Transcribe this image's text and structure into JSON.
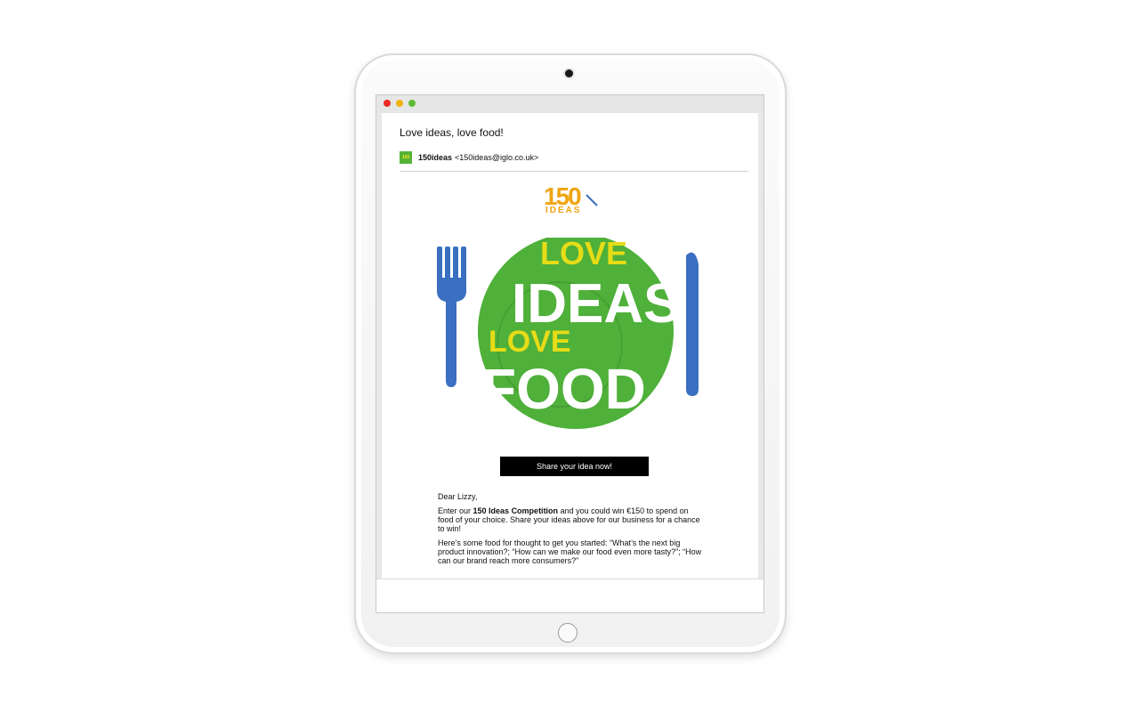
{
  "email": {
    "subject": "Love ideas, love food!",
    "sender_name": "150ideas",
    "sender_email": "<150ideas@iglo.co.uk>",
    "sender_avatar_text": "150"
  },
  "logo": {
    "number": "150",
    "subtitle": "IDEAS"
  },
  "hero": {
    "line1": "LOVE",
    "line2": "IDEAS",
    "line3": "LOVE",
    "line4": "FOOD"
  },
  "cta_label": "Share your idea now!",
  "body": {
    "greeting": "Dear Lizzy,",
    "p1_pre": "Enter our ",
    "p1_bold": "150 Ideas Competition",
    "p1_post": " and you could win €150 to spend on food of your choice. Share your ideas above for our business for a chance to win!",
    "p2": "Here’s some food for thought to get you started: “What’s the next big product innovation?; “How can we make our food even more tasty?”; “How can our brand reach more consumers?”"
  },
  "colors": {
    "green": "#4fb03a",
    "yellow": "#e6dc17",
    "blue": "#3a6fc1",
    "orange": "#f0a513"
  }
}
